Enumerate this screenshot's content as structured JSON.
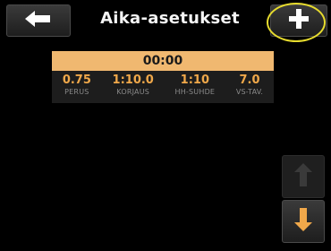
{
  "header": {
    "title": "Aika-asetukset",
    "back_icon": "arrow-left-icon",
    "add_icon": "plus-icon"
  },
  "timer": {
    "value": "00:00",
    "stats": [
      {
        "value": "0.75",
        "label": "PERUS"
      },
      {
        "value": "1:10.0",
        "label": "KORJAUS"
      },
      {
        "value": "1:10",
        "label": "HH-SUHDE"
      },
      {
        "value": "7.0",
        "label": "VS-TAV."
      }
    ]
  },
  "scroll": {
    "up_icon": "arrow-up-icon",
    "down_icon": "arrow-down-icon"
  },
  "colors": {
    "accent": "#f0b870",
    "value_text": "#f0a84a",
    "highlight": "#e6db2e"
  }
}
